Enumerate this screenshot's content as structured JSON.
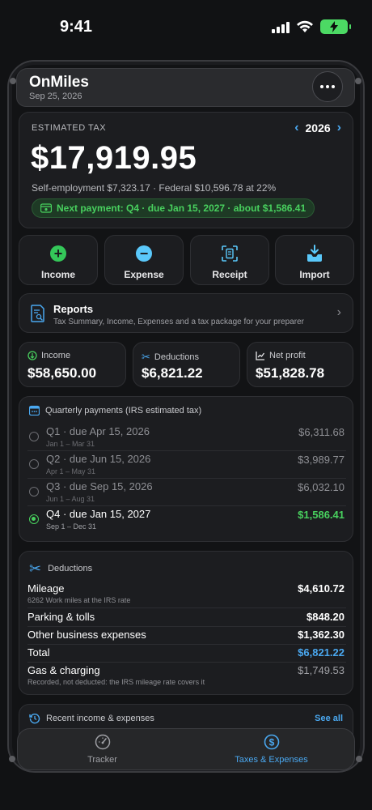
{
  "status_bar": {
    "time": "9:41"
  },
  "app": {
    "title": "OnMiles",
    "date": "Sep 25, 2026"
  },
  "tax": {
    "label": "ESTIMATED TAX",
    "year": "2026",
    "amount": "$17,919.95",
    "breakdown": "Self-employment $7,323.17 · Federal $10,596.78 at 22%",
    "next_payment": "Next payment: Q4 · due Jan 15, 2027 · about $1,586.41"
  },
  "actions": [
    {
      "label": "Income",
      "icon": "plus-circle-icon",
      "color": "#34c759"
    },
    {
      "label": "Expense",
      "icon": "minus-circle-icon",
      "color": "#5ac8fa"
    },
    {
      "label": "Receipt",
      "icon": "receipt-scan-icon",
      "color": "#5ac8fa"
    },
    {
      "label": "Import",
      "icon": "import-tray-icon",
      "color": "#5ac8fa"
    }
  ],
  "reports": {
    "title": "Reports",
    "subtitle": "Tax Summary, Income, Expenses and a tax package for your preparer"
  },
  "stats": [
    {
      "label": "Income",
      "value": "$58,650.00",
      "icon": "dollar-circle-icon"
    },
    {
      "label": "Deductions",
      "value": "$6,821.22",
      "icon": "scissors-icon"
    },
    {
      "label": "Net profit",
      "value": "$51,828.78",
      "icon": "chart-line-icon"
    }
  ],
  "quarterly": {
    "title": "Quarterly payments (IRS estimated tax)",
    "rows": [
      {
        "title": "Q1 · due Apr 15, 2026",
        "range": "Jan 1 – Mar 31",
        "amount": "$6,311.68"
      },
      {
        "title": "Q2 · due Jun 15, 2026",
        "range": "Apr 1 – May 31",
        "amount": "$3,989.77"
      },
      {
        "title": "Q3 · due Sep 15, 2026",
        "range": "Jun 1 – Aug 31",
        "amount": "$6,032.10"
      },
      {
        "title": "Q4 · due Jan 15, 2027",
        "range": "Sep 1 – Dec 31",
        "amount": "$1,586.41"
      }
    ]
  },
  "deductions": {
    "title": "Deductions",
    "mileage": {
      "name": "Mileage",
      "sub": "6262 Work miles at the IRS rate",
      "value": "$4,610.72"
    },
    "parking": {
      "name": "Parking & tolls",
      "value": "$848.20"
    },
    "other": {
      "name": "Other business expenses",
      "value": "$1,362.30"
    },
    "total": {
      "name": "Total",
      "value": "$6,821.22"
    },
    "gas": {
      "name": "Gas & charging",
      "sub": "Recorded, not deducted: the IRS mileage rate covers it",
      "value": "$1,749.53"
    }
  },
  "recent": {
    "title": "Recent income & expenses",
    "see_all": "See all"
  },
  "tabs": [
    {
      "label": "Tracker"
    },
    {
      "label": "Taxes & Expenses"
    }
  ],
  "colors": {
    "accent_blue": "#4aa8f0",
    "accent_green": "#48d05e",
    "card_bg": "#1c1d20"
  }
}
